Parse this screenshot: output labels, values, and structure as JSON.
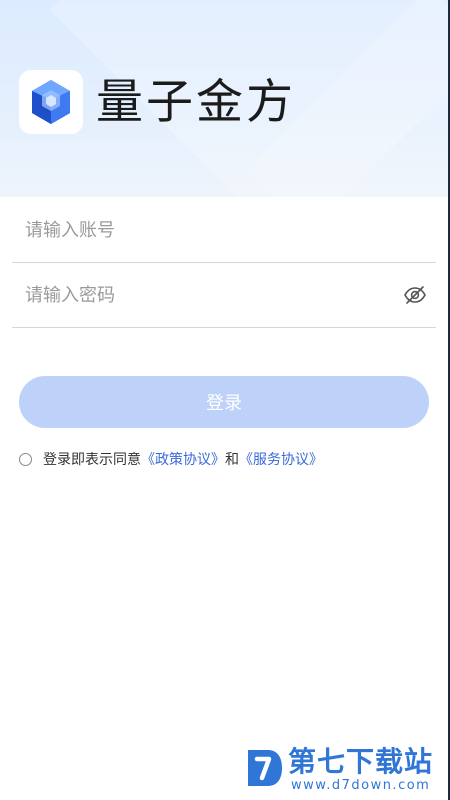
{
  "header": {
    "app_name": "量子金方",
    "logo_icon": "crystal-gem-icon"
  },
  "login_form": {
    "account": {
      "placeholder": "请输入账号",
      "value": ""
    },
    "password": {
      "placeholder": "请输入密码",
      "value": "",
      "toggle_icon": "eye-off-icon"
    },
    "login_button": "登录"
  },
  "agreement": {
    "checked": false,
    "prefix": "登录即表示同意",
    "policy_link": "《政策协议》",
    "conjunction": "和",
    "service_link": "《服务协议》"
  },
  "watermark": {
    "title": "第七下载站",
    "url": "www.d7down.com"
  },
  "colors": {
    "header_bg": "#dcebff",
    "button_bg": "#bed1f8",
    "link": "#3a6ad7",
    "watermark": "#2f76d6"
  }
}
